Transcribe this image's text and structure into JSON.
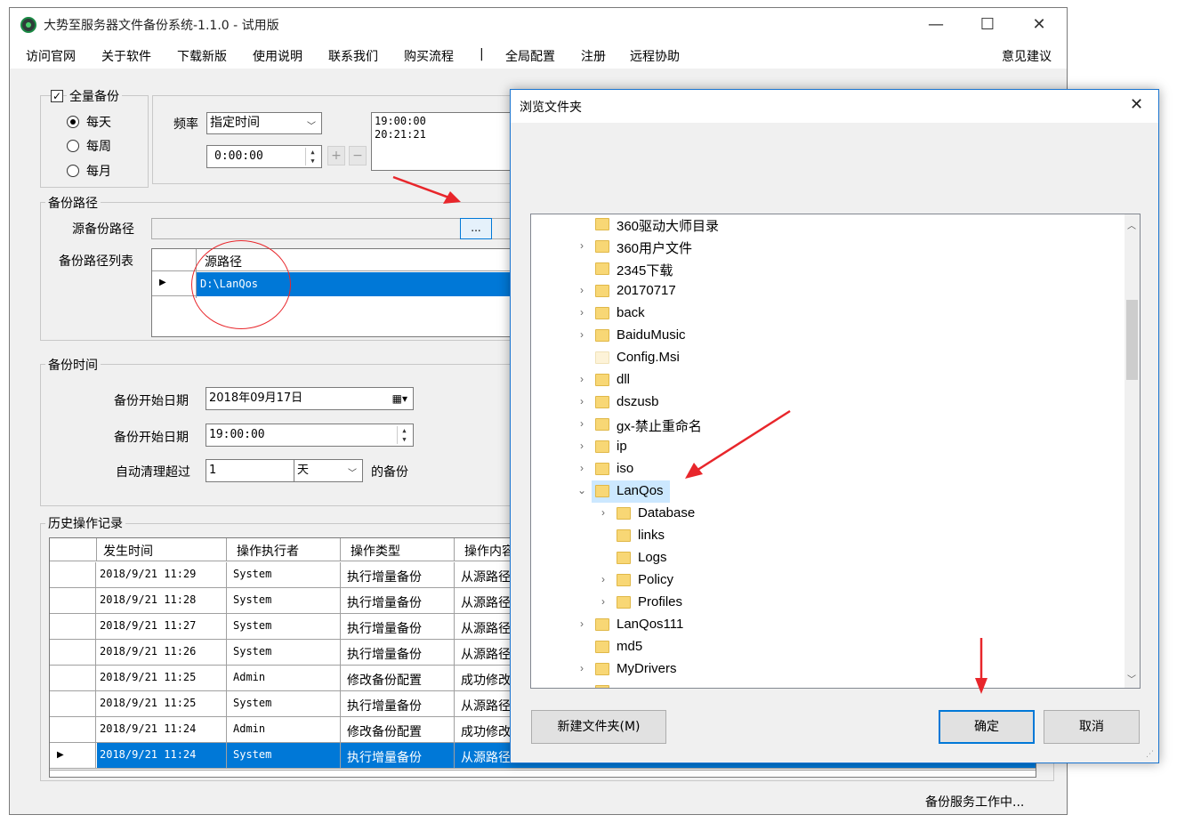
{
  "main_window": {
    "title": "大势至服务器文件备份系统-1.1.0 - 试用版",
    "controls": {
      "minimize": "—",
      "maximize": "☐",
      "close": "✕"
    },
    "menu": [
      "访问官网",
      "关于软件",
      "下载新版",
      "使用说明",
      "联系我们",
      "购买流程",
      "|",
      "全局配置",
      "注册",
      "远程协助"
    ],
    "menu_right": "意见建议"
  },
  "full_backup": {
    "checkbox_label": "全量备份",
    "checked": true,
    "daily": "每天",
    "weekly": "每周",
    "monthly": "每月",
    "selected": "每天",
    "freq_label": "频率",
    "freq_value": "指定时间",
    "time_value": "0:00:00",
    "add": "+",
    "remove": "−",
    "times": [
      "19:00:00",
      "20:21:21"
    ]
  },
  "backup_path": {
    "group": "备份路径",
    "source_label": "源备份路径",
    "browse": "...",
    "list_label": "备份路径列表",
    "column": "源路径",
    "rows": [
      "D:\\LanQos"
    ]
  },
  "backup_time": {
    "group": "备份时间",
    "start_date_label": "备份开始日期",
    "start_date_value": "2018年09月17日",
    "start_time_label": "备份开始日期",
    "start_time_value": "19:00:00",
    "cleanup_label": "自动清理超过",
    "cleanup_value": "1",
    "cleanup_unit": "天",
    "cleanup_suffix": "的备份"
  },
  "history": {
    "group": "历史操作记录",
    "columns": [
      "发生时间",
      "操作执行者",
      "操作类型",
      "操作内容"
    ],
    "rows": [
      [
        "2018/9/21 11:29",
        "System",
        "执行增量备份",
        "从源路径"
      ],
      [
        "2018/9/21 11:28",
        "System",
        "执行增量备份",
        "从源路径"
      ],
      [
        "2018/9/21 11:27",
        "System",
        "执行增量备份",
        "从源路径"
      ],
      [
        "2018/9/21 11:26",
        "System",
        "执行增量备份",
        "从源路径"
      ],
      [
        "2018/9/21 11:25",
        "Admin",
        "修改备份配置",
        "成功修改"
      ],
      [
        "2018/9/21 11:25",
        "System",
        "执行增量备份",
        "从源路径"
      ],
      [
        "2018/9/21 11:24",
        "Admin",
        "修改备份配置",
        "成功修改"
      ],
      [
        "2018/9/21 11:24",
        "System",
        "执行增量备份",
        "从源路径"
      ]
    ],
    "selected_row": 7,
    "status": "备份服务工作中..."
  },
  "dialog": {
    "title": "浏览文件夹",
    "close": "✕",
    "tree": [
      {
        "label": "360驱动大师目录",
        "level": 0,
        "chevron": "",
        "pale": false
      },
      {
        "label": "360用户文件",
        "level": 0,
        "chevron": "›",
        "pale": false
      },
      {
        "label": "2345下载",
        "level": 0,
        "chevron": "",
        "pale": false
      },
      {
        "label": "20170717",
        "level": 0,
        "chevron": "›",
        "pale": false
      },
      {
        "label": "back",
        "level": 0,
        "chevron": "›",
        "pale": false
      },
      {
        "label": "BaiduMusic",
        "level": 0,
        "chevron": "›",
        "pale": false
      },
      {
        "label": "Config.Msi",
        "level": 0,
        "chevron": "",
        "pale": true
      },
      {
        "label": "dll",
        "level": 0,
        "chevron": "›",
        "pale": false
      },
      {
        "label": "dszusb",
        "level": 0,
        "chevron": "›",
        "pale": false
      },
      {
        "label": "gx-禁止重命名",
        "level": 0,
        "chevron": "›",
        "pale": false
      },
      {
        "label": "ip",
        "level": 0,
        "chevron": "›",
        "pale": false
      },
      {
        "label": "iso",
        "level": 0,
        "chevron": "›",
        "pale": false
      },
      {
        "label": "LanQos",
        "level": 0,
        "chevron": "⌄",
        "pale": false,
        "selected": true
      },
      {
        "label": "Database",
        "level": 1,
        "chevron": "›",
        "pale": false
      },
      {
        "label": "links",
        "level": 1,
        "chevron": "",
        "pale": false
      },
      {
        "label": "Logs",
        "level": 1,
        "chevron": "",
        "pale": false
      },
      {
        "label": "Policy",
        "level": 1,
        "chevron": "›",
        "pale": false
      },
      {
        "label": "Profiles",
        "level": 1,
        "chevron": "›",
        "pale": false
      },
      {
        "label": "LanQos111",
        "level": 0,
        "chevron": "›",
        "pale": false
      },
      {
        "label": "md5",
        "level": 0,
        "chevron": "",
        "pale": false
      },
      {
        "label": "MyDrivers",
        "level": 0,
        "chevron": "›",
        "pale": false
      }
    ],
    "new_folder": "新建文件夹(M)",
    "ok": "确定",
    "cancel": "取消"
  },
  "colors": {
    "selection": "#0078d7",
    "tree_selection": "#cce8ff",
    "annotation": "#e8262b"
  }
}
